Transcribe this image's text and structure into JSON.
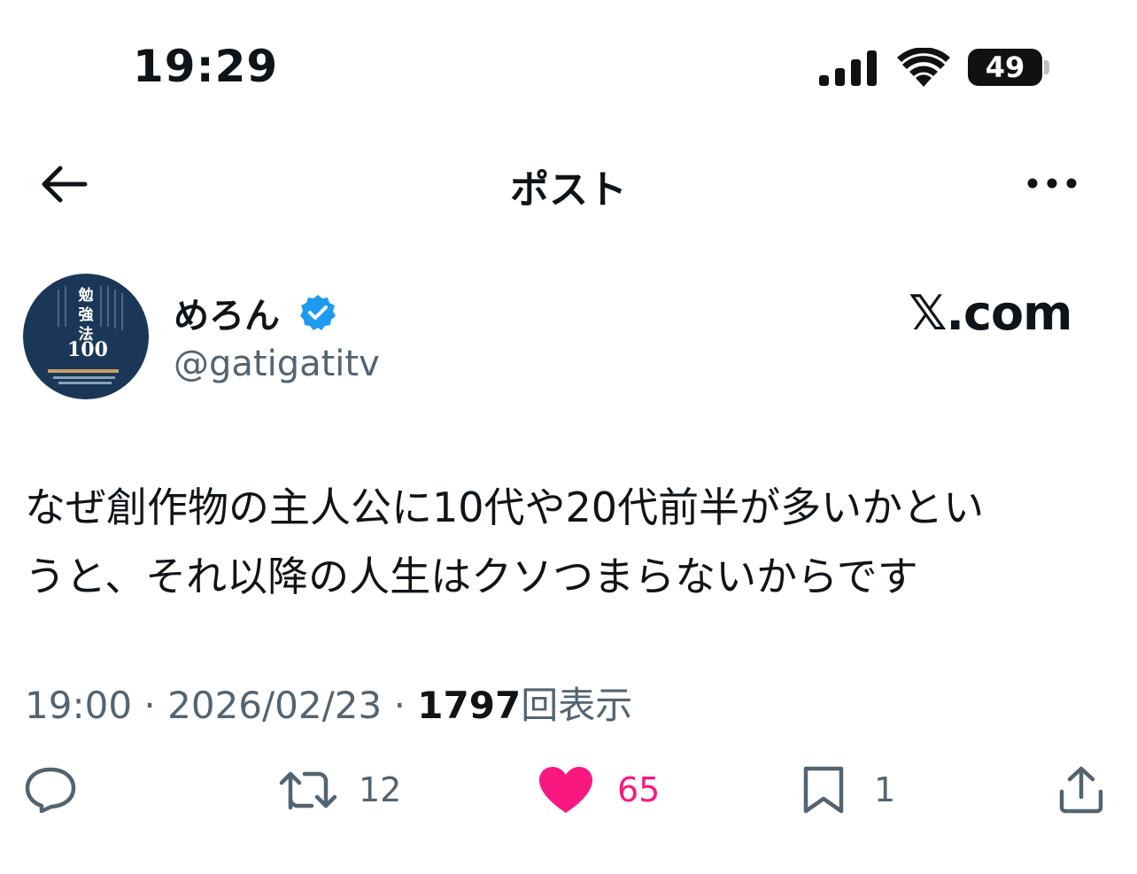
{
  "status_bar": {
    "time": "19:29",
    "battery": "49",
    "icons": [
      "signal-icon",
      "wifi-icon",
      "battery-icon"
    ]
  },
  "header": {
    "title": "ポスト",
    "back_icon": "arrow-left-icon",
    "more_icon": "more-horizontal-icon"
  },
  "post": {
    "author": {
      "name": "めろん",
      "verified_icon": "verified-badge-icon",
      "handle": "@gatigatitv",
      "avatar": {
        "title_text": "勉強法",
        "number": "100"
      }
    },
    "source": "𝕏.com",
    "text_line1": "なぜ創作物の主人公に10代や20代前半が多いかとい",
    "text_line2": "うと、それ以降の人生はクソつまらないからです",
    "time": "19:00",
    "separator": "·",
    "date": "2026/02/23",
    "views": "1797",
    "views_label": "回表示"
  },
  "actions": {
    "reply_icon": "reply-icon",
    "retweets": "12",
    "likes": "65",
    "bookmarks": "1",
    "share_icon": "share-icon",
    "like_color": "#f91880",
    "secondary_color": "#536471"
  }
}
